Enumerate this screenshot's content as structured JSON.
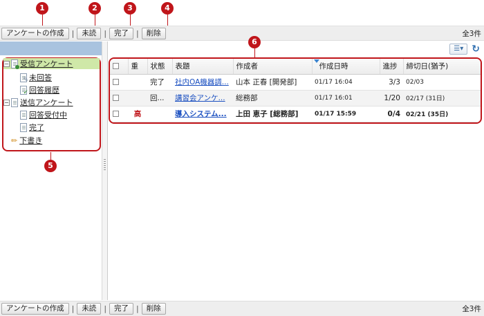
{
  "toolbar": {
    "create_label": "アンケートの作成",
    "unread_label": "未読",
    "complete_label": "完了",
    "delete_label": "削除",
    "separator": "|",
    "count": "全3件"
  },
  "callouts": [
    "1",
    "2",
    "3",
    "4",
    "5",
    "6"
  ],
  "tree": {
    "received": "受信アンケート",
    "unanswered": "未回答",
    "answer_history": "回答履歴",
    "sent": "送信アンケート",
    "accepting": "回答受付中",
    "completed": "完了",
    "drafts": "下書き",
    "expanded_symbol": "−"
  },
  "grid": {
    "columns": {
      "priority": "重",
      "status": "状態",
      "title": "表題",
      "creator": "作成者",
      "created": "作成日時",
      "progress": "進捗",
      "deadline": "締切日(猶予)"
    },
    "rows": [
      {
        "priority": "",
        "status": "完了",
        "title": "社内OA機器調...",
        "creator": "山本 正春 [開発部]",
        "created": "01/17 16:04",
        "progress": "3/3",
        "deadline": "02/03"
      },
      {
        "priority": "",
        "status": "回...",
        "title": "講習会アンケ...",
        "creator": "総務部",
        "created": "01/17 16:01",
        "progress": "1/20",
        "deadline": "02/17 (31日)"
      },
      {
        "priority": "高",
        "status": "",
        "title": "導入システム...",
        "creator": "上田 恵子 [総務部]",
        "created": "01/17 15:59",
        "progress": "0/4",
        "deadline": "02/21 (35日)"
      }
    ]
  },
  "colors": {
    "callout": "#c0151a",
    "tree_header": "#a9c3df",
    "selected": "#cfe8a8",
    "link": "#1a4fc0"
  }
}
